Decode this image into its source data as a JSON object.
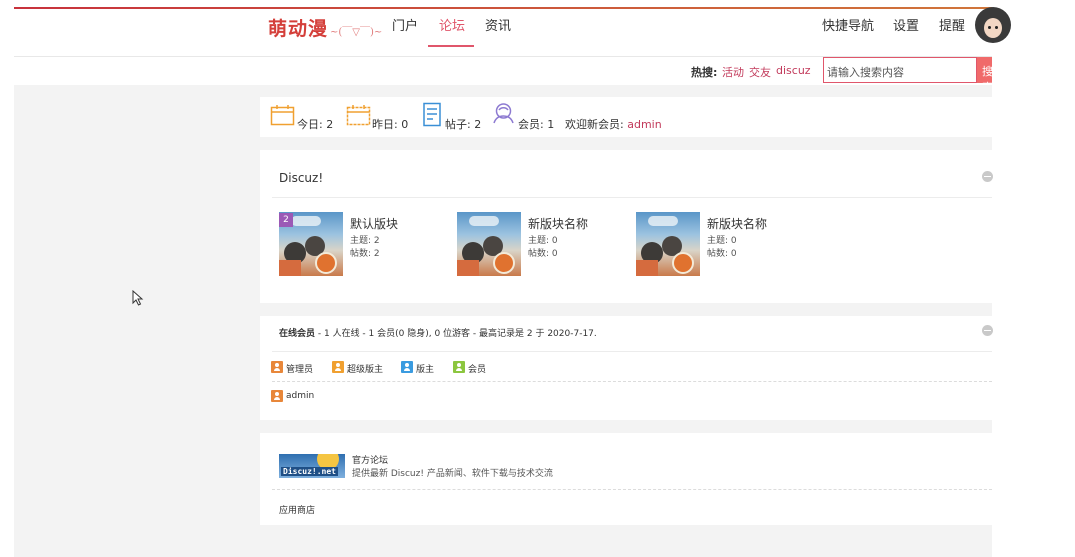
{
  "header": {
    "logo_main": "萌动漫",
    "logo_sub": "~(￣▽￣)~",
    "nav": [
      "门户",
      "论坛",
      "资讯"
    ],
    "active_nav": "论坛",
    "right_links": [
      "快捷导航",
      "设置",
      "提醒"
    ]
  },
  "search": {
    "hot_label": "热搜:",
    "hot_links": [
      "活动",
      "交友",
      "discuz"
    ],
    "placeholder": "请输入搜索内容",
    "button_label": "搜索"
  },
  "stats": {
    "today": "今日: 2",
    "yesterday": "昨日: 0",
    "posts": "帖子: 2",
    "members": "会员: 1",
    "welcome": "欢迎新会员:",
    "new_member": "admin"
  },
  "category": {
    "title": "Discuz!",
    "forums": [
      {
        "name": "默认版块",
        "topics": "主题: 2",
        "posts": "帖数: 2",
        "badge": "2"
      },
      {
        "name": "新版块名称",
        "topics": "主题: 0",
        "posts": "帖数: 0"
      },
      {
        "name": "新版块名称",
        "topics": "主题: 0",
        "posts": "帖数: 0"
      }
    ]
  },
  "online": {
    "title_prefix": "在线会员",
    "title_rest": " - 1 人在线 - 1 会员(0 隐身), 0 位游客 - 最高记录是 2 于 2020-7-17.",
    "legend": [
      {
        "label": "管理员",
        "color": "#e8873a"
      },
      {
        "label": "超级版主",
        "color": "#f0a030"
      },
      {
        "label": "版主",
        "color": "#3a9be0"
      },
      {
        "label": "会员",
        "color": "#8cc63f"
      }
    ],
    "users": [
      "admin"
    ]
  },
  "links": {
    "logo_label": "Discuz!.net",
    "title": "官方论坛",
    "description": "提供最新 Discuz! 产品新闻、软件下载与技术交流",
    "app_store": "应用商店"
  }
}
